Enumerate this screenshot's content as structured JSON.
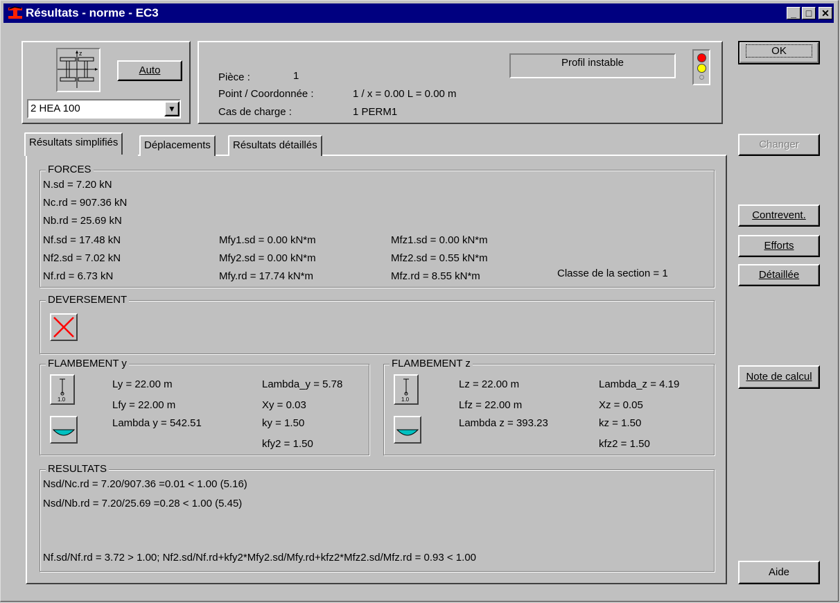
{
  "window": {
    "title": "Résultats - norme - EC3",
    "minimize": "_",
    "maximize": "□",
    "close": "✕"
  },
  "section": {
    "auto_label": "Auto",
    "profile_value": "2 HEA 100"
  },
  "info": {
    "piece_label": "Pièce :",
    "piece_value": "1",
    "point_label": "Point / Coordonnée :",
    "point_value": "1 / x = 0.00 L = 0.00 m",
    "case_label": "Cas de charge :",
    "case_value": "1 PERM1",
    "status": "Profil instable"
  },
  "buttons": {
    "ok": "OK",
    "changer": "Changer",
    "contrevent": "Contrevent.",
    "efforts": "Efforts",
    "detaillee": "Détaillée",
    "note": "Note de calcul",
    "aide": "Aide"
  },
  "tabs": [
    "Résultats simplifiés",
    "Déplacements",
    "Résultats détaillés"
  ],
  "forces": {
    "title": "FORCES",
    "nsd": "N.sd = 7.20 kN",
    "ncrd": "Nc.rd = 907.36 kN",
    "nbrd": "Nb.rd = 25.69 kN",
    "nfsd": "Nf.sd = 17.48 kN",
    "nf2sd": "Nf2.sd = 7.02 kN",
    "nfrd": "Nf.rd = 6.73 kN",
    "mfy1sd": "Mfy1.sd = 0.00 kN*m",
    "mfy2sd": "Mfy2.sd = 0.00 kN*m",
    "mfyrd": "Mfy.rd = 17.74 kN*m",
    "mfz1sd": "Mfz1.sd = 0.00 kN*m",
    "mfz2sd": "Mfz2.sd = 0.55 kN*m",
    "mfzrd": "Mfz.rd = 8.55 kN*m",
    "classe": "Classe de la section = 1"
  },
  "deversement": {
    "title": "DEVERSEMENT"
  },
  "flamb_y": {
    "title": "FLAMBEMENT y",
    "icon_value": "1.0",
    "ly": "Ly = 22.00 m",
    "lfy": "Lfy = 22.00 m",
    "lambda": "Lambda y = 542.51",
    "lambda_bar": "Lambda_y = 5.78",
    "x": "Xy = 0.03",
    "k": "ky = 1.50",
    "kf2": "kfy2 = 1.50"
  },
  "flamb_z": {
    "title": "FLAMBEMENT z",
    "icon_value": "1.0",
    "lz": "Lz = 22.00 m",
    "lfz": "Lfz = 22.00 m",
    "lambda": "Lambda z = 393.23",
    "lambda_bar": "Lambda_z = 4.19",
    "x": "Xz = 0.05",
    "k": "kz = 1.50",
    "kf2": "kfz2 = 1.50"
  },
  "resultats": {
    "title": "RESULTATS",
    "line1": "Nsd/Nc.rd = 7.20/907.36 =0.01 < 1.00  (5.16)",
    "line2": "Nsd/Nb.rd = 7.20/25.69 =0.28 < 1.00  (5.45)",
    "line3": "Nf.sd/Nf.rd = 3.72 > 1.00; Nf2.sd/Nf.rd+kfy2*Mfy2.sd/Mfy.rd+kfz2*Mfz2.sd/Mfz.rd = 0.93 < 1.00"
  },
  "colors": {
    "titlebar": "#000080",
    "light_red": "#ff0000",
    "light_yellow": "#ffff00",
    "cross": "#ff0000",
    "cyan": "#00c0c0"
  }
}
